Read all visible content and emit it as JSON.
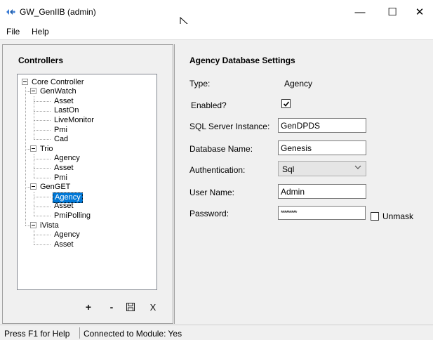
{
  "window": {
    "title": "GW_GenIIB (admin)",
    "min_glyph": "—",
    "max_glyph": "☐",
    "close_glyph": "✕"
  },
  "menu": {
    "items": [
      "File",
      "Help"
    ]
  },
  "controllers_panel": {
    "heading": "Controllers",
    "tree": [
      {
        "label": "Core Controller",
        "level": 0
      },
      {
        "label": "GenWatch",
        "level": 1
      },
      {
        "label": "Asset",
        "level": 2
      },
      {
        "label": "LastOn",
        "level": 2
      },
      {
        "label": "LiveMonitor",
        "level": 2
      },
      {
        "label": "Pmi",
        "level": 2
      },
      {
        "label": "Cad",
        "level": 2
      },
      {
        "label": "Trio",
        "level": 1
      },
      {
        "label": "Agency",
        "level": 2
      },
      {
        "label": "Asset",
        "level": 2
      },
      {
        "label": "Pmi",
        "level": 2
      },
      {
        "label": "GenGET",
        "level": 1
      },
      {
        "label": "Agency",
        "level": 2,
        "selected": true
      },
      {
        "label": "Asset",
        "level": 2
      },
      {
        "label": "PmiPolling",
        "level": 2
      },
      {
        "label": "iVista",
        "level": 1
      },
      {
        "label": "Agency",
        "level": 2
      },
      {
        "label": "Asset",
        "level": 2
      }
    ],
    "toolbar": {
      "add": "+",
      "remove": "-",
      "delete": "X",
      "save_icon": "save-icon"
    }
  },
  "settings": {
    "heading": "Agency Database Settings",
    "type_label": "Type:",
    "type_value": "Agency",
    "enabled_label": "Enabled?",
    "enabled_checked": true,
    "sql_label": "SQL Server Instance:",
    "sql_value": "GenDPDS",
    "db_label": "Database Name:",
    "db_value": "Genesis",
    "auth_label": "Authentication:",
    "auth_value": "Sql",
    "user_label": "User Name:",
    "user_value": "Admin",
    "password_label": "Password:",
    "password_value": "*********",
    "unmask_label": "Unmask"
  },
  "status": {
    "help": "Press F1 for Help",
    "connection": "Connected to Module: Yes"
  },
  "colors": {
    "selection": "#0078d7",
    "panel_bg": "#f0f0f0"
  }
}
